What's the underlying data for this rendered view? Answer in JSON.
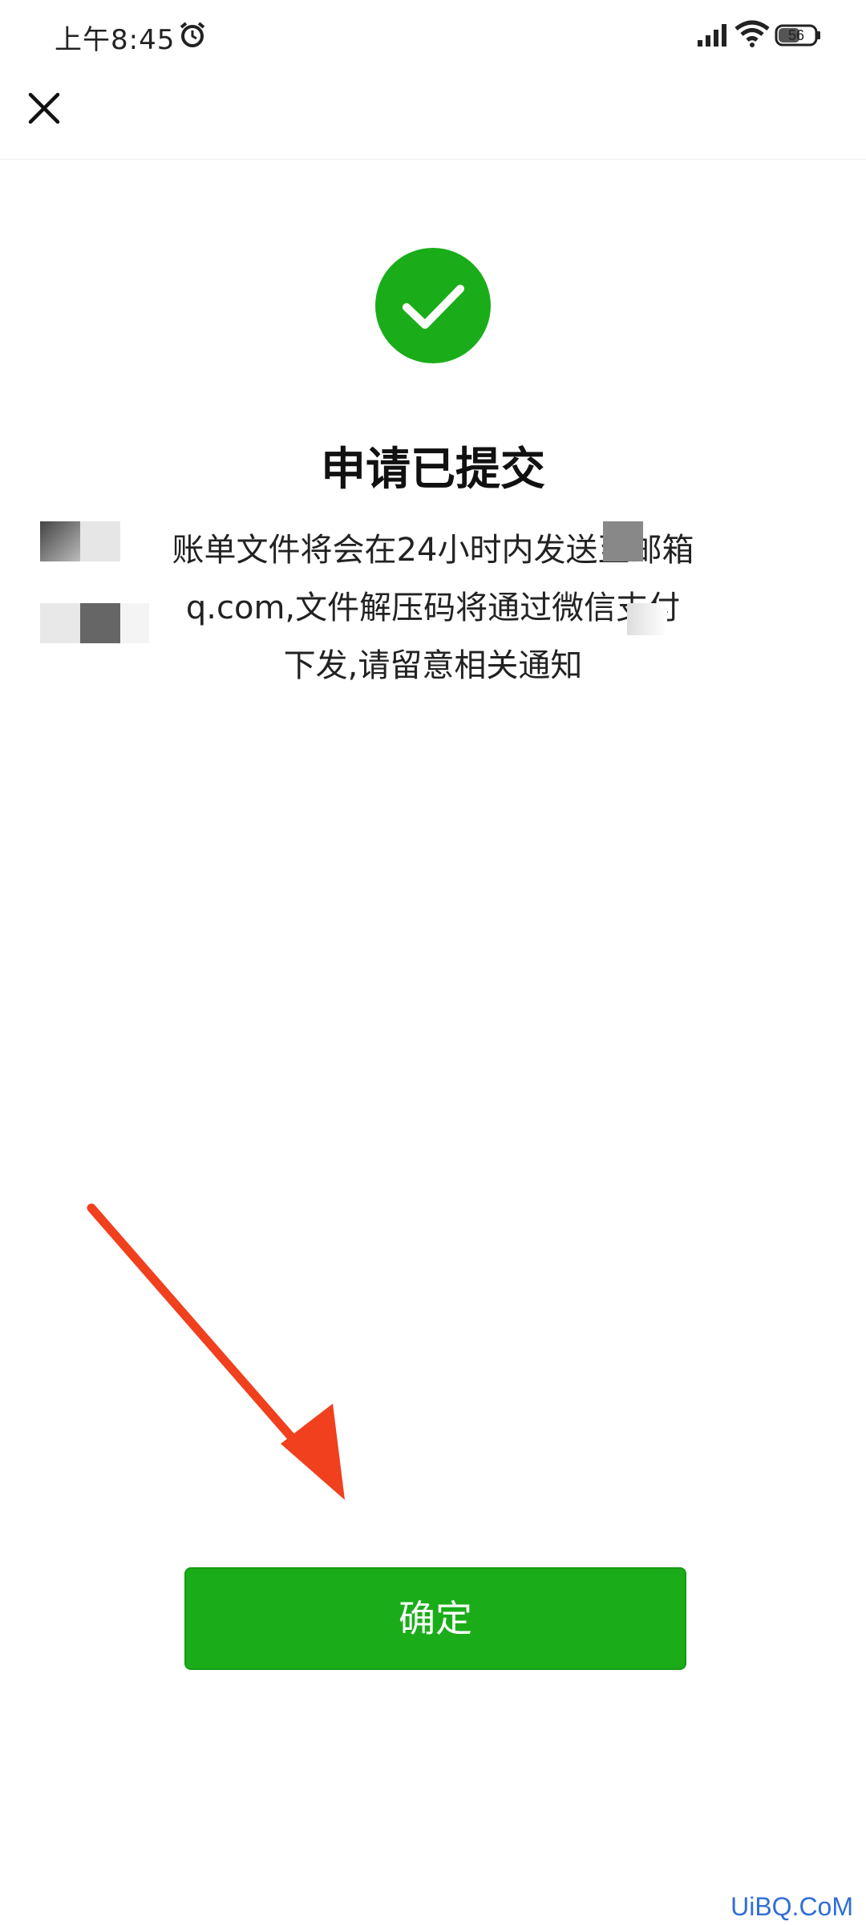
{
  "status_bar": {
    "time": "上午8:45",
    "battery": "56",
    "icons": [
      "alarm-icon",
      "signal-icon",
      "wifi-icon",
      "battery-icon"
    ]
  },
  "header": {
    "close_icon": "close-icon"
  },
  "result": {
    "icon": "checkmark-circle-icon",
    "title": "申请已提交",
    "message_lines": [
      "账单文件将会在24小时内发送至邮箱",
      "q.com,文件解压码将通过微信支付",
      "下发,请留意相关通知"
    ]
  },
  "actions": {
    "confirm_label": "确定"
  },
  "watermark": "UiBQ.CoM",
  "colors": {
    "accent": "#1aad19",
    "arrow": "#f0401e",
    "watermark": "#2f6fd6"
  }
}
